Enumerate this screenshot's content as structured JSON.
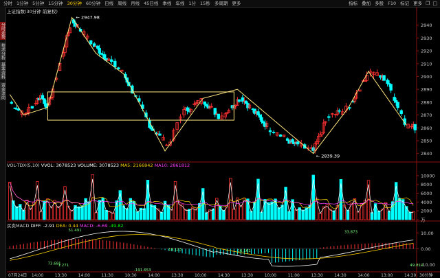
{
  "toolbar": {
    "periods": [
      "分时",
      "1分钟",
      "5分钟",
      "15分钟",
      "30分钟",
      "60分钟",
      "日线",
      "周线",
      "月线",
      "45日线",
      "季线",
      "年线",
      "1分",
      "15秒",
      "多周期",
      "更多"
    ],
    "active_period": "30分钟",
    "right_items": [
      "指标",
      "叠加",
      "多股",
      "F10",
      "标记",
      "更多"
    ],
    "right_icons": [
      "restore-icon",
      "maximize-icon"
    ]
  },
  "sidebar": {
    "tabs": [
      "分时走势",
      "技术分析",
      "基本资料",
      "资金流向"
    ]
  },
  "main_chart": {
    "title": "上证指数(30分钟 前复权)",
    "high_label": "2947.98",
    "low_label": "2839.39",
    "y_ticks": [
      "2940",
      "2930",
      "2920",
      "2910",
      "2900",
      "2890",
      "2880",
      "2870",
      "2860",
      "2850",
      "2840"
    ]
  },
  "volume_panel": {
    "label_main": "VOL-TDX(5,10)",
    "vvol": "VVOL: 3078523",
    "volume": "VOLUME: 3078523",
    "ma5": "MA5: 2166942",
    "ma10": "MA10: 2861812",
    "y_ticks": [
      "10000",
      "8000",
      "6000",
      "4000",
      "2000",
      "万"
    ]
  },
  "macd_panel": {
    "label_main": "买卖MACD",
    "diff": "DIFF: -2.91",
    "dea": "DEA: 0.44",
    "macd": "MACD: -6.69",
    "extra": "-49.82",
    "y_ticks": [
      "10.00",
      "0.00",
      "-10.00"
    ],
    "annotations": [
      "51.491",
      "18.123",
      "16.161",
      "33.873",
      "73.681",
      "1.271",
      "-191.653",
      "49.810"
    ]
  },
  "x_axis": {
    "labels": [
      "07月24日",
      "14:00",
      "13:30",
      "14:00",
      "11:30",
      "10:30",
      "14:00",
      "13:30",
      "10:00",
      "14:30",
      "13:30",
      "10:00",
      "11:00",
      "13:30",
      "14:30",
      "14:00",
      "13:00",
      "14:30",
      "30分钟"
    ]
  },
  "colors": {
    "up": "#ff3232",
    "down": "#00ffff",
    "ma_white": "#ffffff",
    "ma_yellow": "#ffd200",
    "ma_magenta": "#ff40ff",
    "zone": "#ffe680"
  }
}
